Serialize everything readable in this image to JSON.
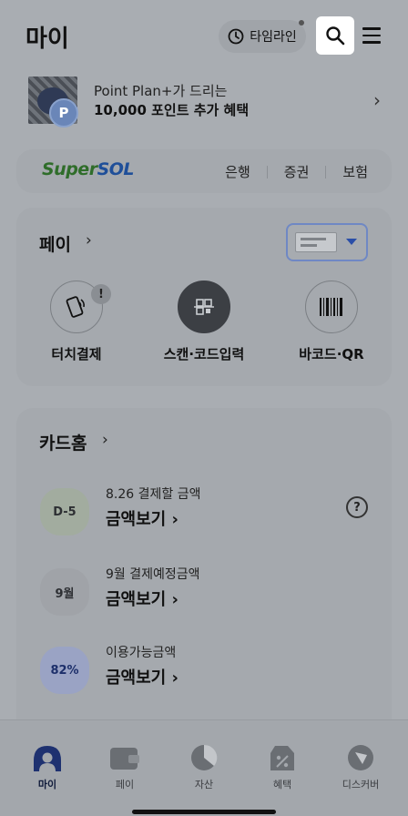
{
  "header": {
    "title": "마이",
    "timeline_label": "타임라인"
  },
  "promo": {
    "line1": "Point Plan+가 드리는",
    "line2": "10,000 포인트 추가 혜택",
    "coin": "P"
  },
  "super_sol": {
    "logo_part1": "Super",
    "logo_part2": "SOL",
    "links": [
      "은행",
      "증권",
      "보험"
    ]
  },
  "pay": {
    "title": "페이",
    "items": [
      {
        "label": "터치결제",
        "alert": "!"
      },
      {
        "label": "스캔·코드입력"
      },
      {
        "label": "바코드·QR"
      }
    ]
  },
  "card_home": {
    "title": "카드홈",
    "rows": [
      {
        "badge": "D-5",
        "subtitle": "8.26 결제할 금액",
        "amount": "금액보기 ›"
      },
      {
        "badge": "9월",
        "subtitle": "9월 결제예정금액",
        "amount": "금액보기 ›"
      },
      {
        "badge": "82%",
        "subtitle": "이용가능금액",
        "amount": "금액보기 ›"
      }
    ],
    "help": "?"
  },
  "tabbar": {
    "tabs": [
      {
        "label": "마이",
        "icon": "person-icon",
        "active": true
      },
      {
        "label": "페이",
        "icon": "wallet-icon"
      },
      {
        "label": "자산",
        "icon": "pie-chart-icon"
      },
      {
        "label": "혜택",
        "icon": "coupon-icon"
      },
      {
        "label": "디스커버",
        "icon": "compass-icon"
      }
    ]
  },
  "colors": {
    "active_tab": "#1e3170",
    "card_select_border": "#6f88c4"
  }
}
